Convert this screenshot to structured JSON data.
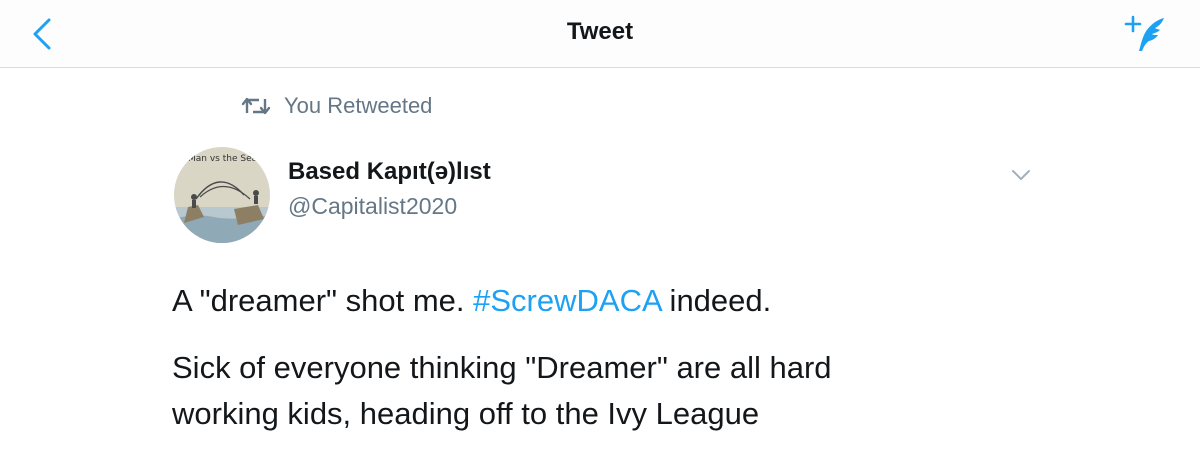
{
  "nav": {
    "title": "Tweet"
  },
  "retweet_context": {
    "label": "You Retweeted"
  },
  "author": {
    "name": "Based Kapıt(ə)lıst",
    "handle": "@Capitalist2020",
    "avatar_caption": "Man vs the Sea"
  },
  "tweet": {
    "line1_before": "A \"dreamer\" shot me. ",
    "hashtag": "#ScrewDACA",
    "line1_after": " indeed.",
    "paragraph2": "Sick of everyone thinking \"Dreamer\" are all hard working kids, heading off to the Ivy League"
  },
  "icons": {
    "back": "chevron-left-icon",
    "compose": "compose-tweet-icon",
    "retweet": "retweet-icon",
    "caret": "chevron-down-icon"
  },
  "colors": {
    "accent": "#1da1f2",
    "text": "#14171a",
    "secondary": "#657786"
  }
}
